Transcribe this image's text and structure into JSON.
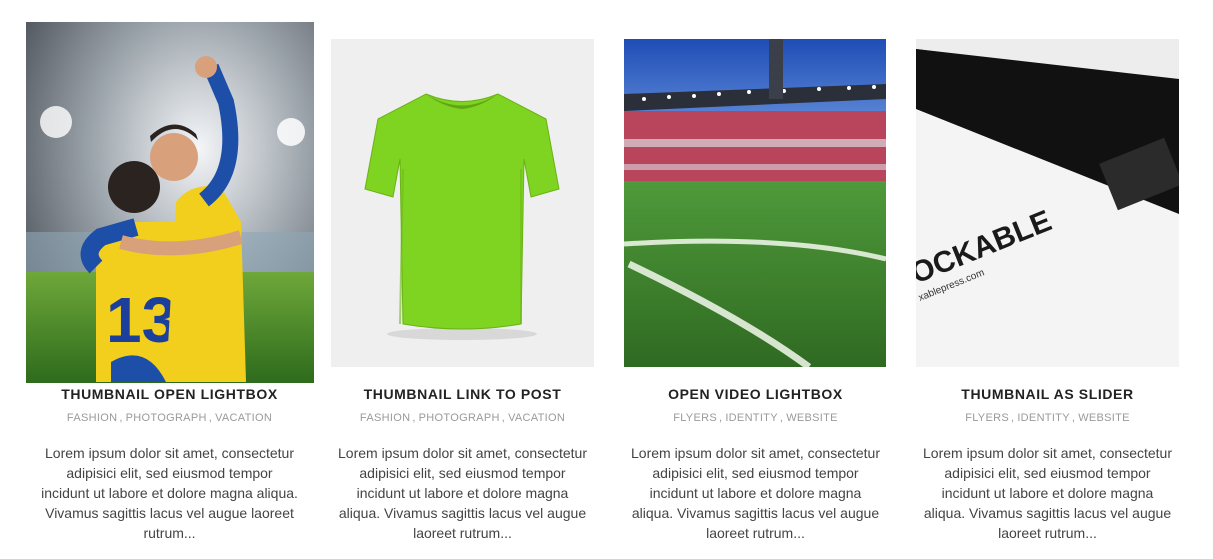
{
  "portfolio": {
    "items": [
      {
        "title": "THUMBNAIL OPEN LIGHTBOX",
        "categories": [
          "FASHION",
          "PHOTOGRAPH",
          "VACATION"
        ],
        "excerpt": "Lorem ipsum dolor sit amet, consectetur adipisici elit, sed eiusmod tempor incidunt ut labore et dolore magna aliqua. Vivamus sagittis lacus vel augue laoreet rutrum...",
        "image_icon": "football-players-photo",
        "jersey_number": "13"
      },
      {
        "title": "THUMBNAIL LINK TO POST",
        "categories": [
          "FASHION",
          "PHOTOGRAPH",
          "VACATION"
        ],
        "excerpt": "Lorem ipsum dolor sit amet, consectetur adipisici elit, sed eiusmod tempor incidunt ut labore et dolore magna aliqua. Vivamus sagittis lacus vel augue laoreet rutrum...",
        "image_icon": "green-tshirt-photo"
      },
      {
        "title": "OPEN VIDEO LIGHTBOX",
        "categories": [
          "FLYERS",
          "IDENTITY",
          "WEBSITE"
        ],
        "excerpt": "Lorem ipsum dolor sit amet, consectetur adipisici elit, sed eiusmod tempor incidunt ut labore et dolore magna aliqua. Vivamus sagittis lacus vel augue laoreet rutrum...",
        "image_icon": "stadium-pitch-photo"
      },
      {
        "title": "THUMBNAIL AS SLIDER",
        "categories": [
          "FLYERS",
          "IDENTITY",
          "WEBSITE"
        ],
        "excerpt": "Lorem ipsum dolor sit amet, consectetur adipisici elit, sed eiusmod tempor incidunt ut labore et dolore magna aliqua. Vivamus sagittis lacus vel augue laoreet rutrum...",
        "image_icon": "business-card-photo",
        "card_brand": "OCKABLE",
        "card_url": "xablepress.com"
      }
    ]
  },
  "colors": {
    "tshirt": "#7fd321",
    "pitch": "#3f8f2a",
    "jersey": "#f2cf1d",
    "text": "#444444",
    "muted": "#9a9a9a"
  }
}
